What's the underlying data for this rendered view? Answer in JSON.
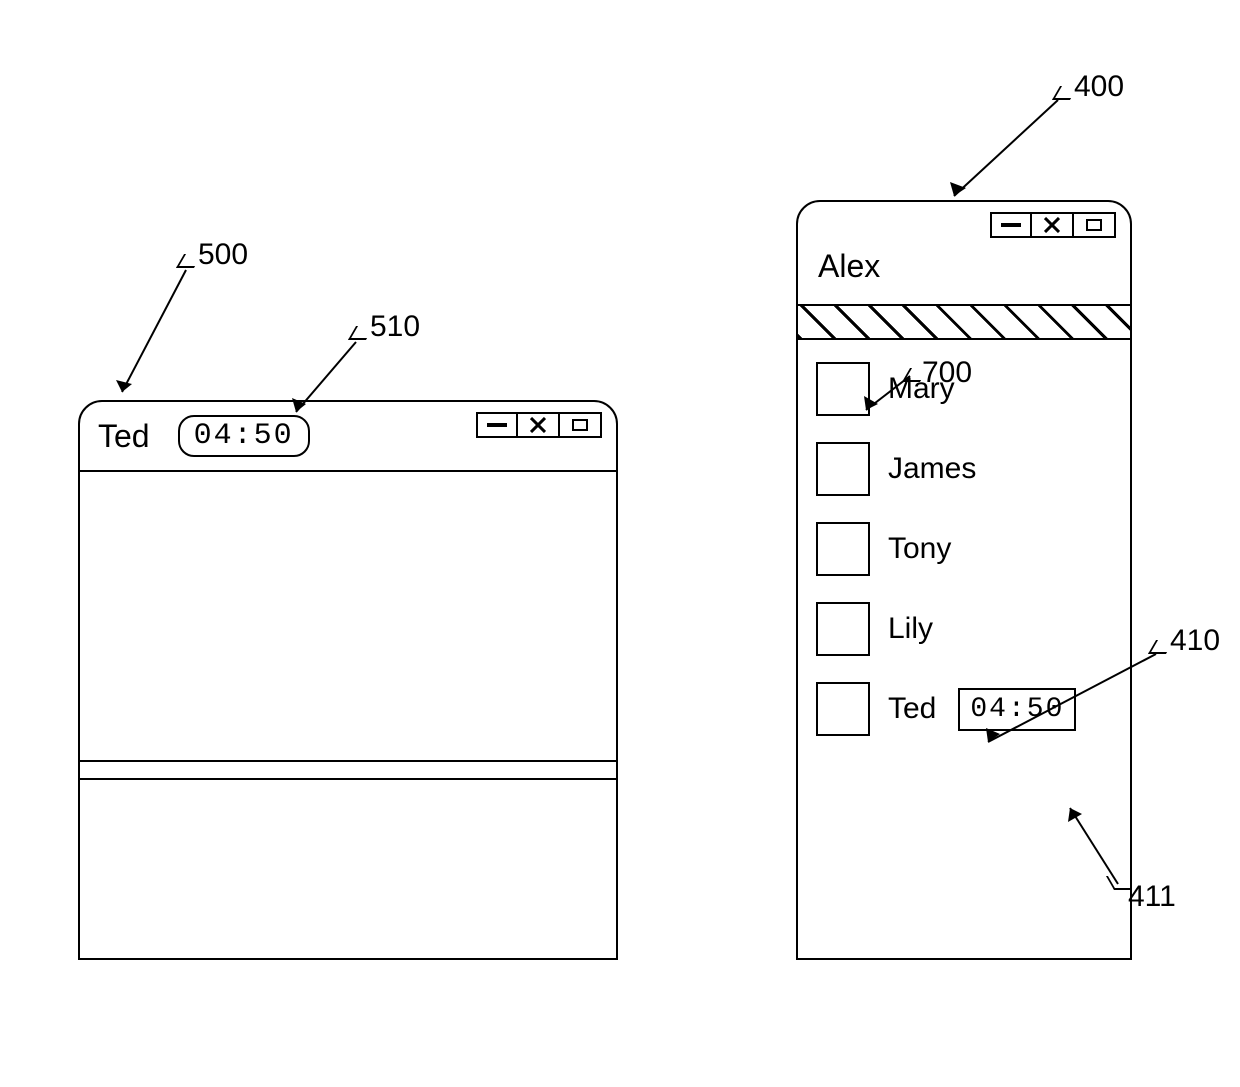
{
  "chat_window": {
    "title": "Ted",
    "timer": "04:50"
  },
  "contact_window": {
    "owner": "Alex",
    "contacts": [
      {
        "name": "Mary"
      },
      {
        "name": "James"
      },
      {
        "name": "Tony"
      },
      {
        "name": "Lily"
      },
      {
        "name": "Ted",
        "timer": "04:50"
      }
    ]
  },
  "refs": {
    "r400": "400",
    "r410": "410",
    "r411": "411",
    "r500": "500",
    "r510": "510",
    "r700": "700"
  }
}
